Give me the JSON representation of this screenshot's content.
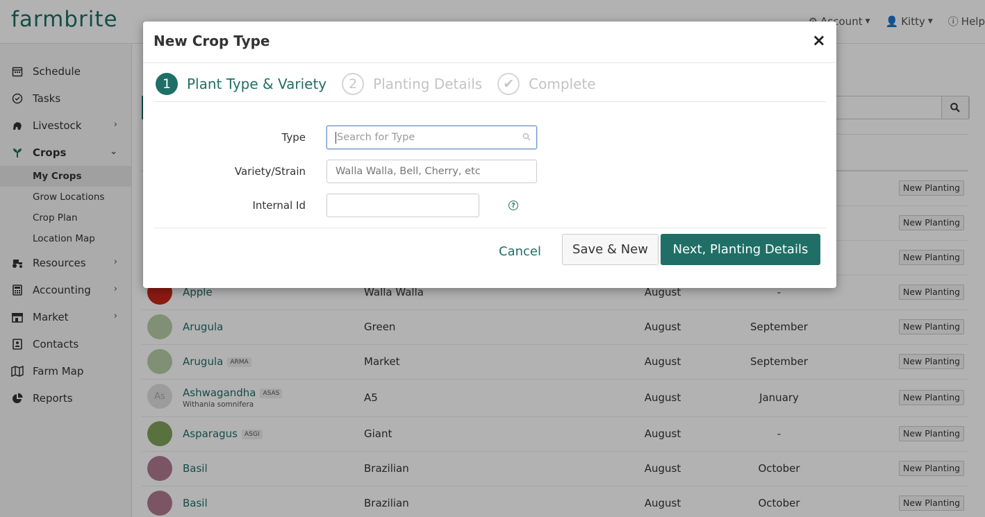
{
  "app": {
    "logo": "farmbrite"
  },
  "topnav": {
    "account": "Account",
    "user": "Kitty",
    "help": "Help"
  },
  "sidebar": {
    "items": [
      {
        "label": "Schedule"
      },
      {
        "label": "Tasks"
      },
      {
        "label": "Livestock"
      },
      {
        "label": "Crops"
      },
      {
        "label": "Resources"
      },
      {
        "label": "Accounting"
      },
      {
        "label": "Market"
      },
      {
        "label": "Contacts"
      },
      {
        "label": "Farm Map"
      },
      {
        "label": "Reports"
      }
    ],
    "crops_sub": [
      "My Crops",
      "Grow Locations",
      "Crop Plan",
      "Location Map"
    ]
  },
  "table": {
    "action_label": "New Planting",
    "rows": [
      {
        "name": "Apple",
        "badge": "",
        "sub": "",
        "variety": "Walla Walla",
        "m1": "August",
        "m2": "-"
      },
      {
        "name": "Arugula",
        "badge": "",
        "sub": "",
        "variety": "Green",
        "m1": "August",
        "m2": "September"
      },
      {
        "name": "Arugula",
        "badge": "ARMA",
        "sub": "",
        "variety": "Market",
        "m1": "August",
        "m2": "September"
      },
      {
        "name": "Ashwagandha",
        "badge": "ASAS",
        "sub": "Withania somnifera",
        "variety": "A5",
        "m1": "August",
        "m2": "January",
        "avatar_text": "As"
      },
      {
        "name": "Asparagus",
        "badge": "ASGI",
        "sub": "",
        "variety": "Giant",
        "m1": "August",
        "m2": "-"
      },
      {
        "name": "Basil",
        "badge": "",
        "sub": "",
        "variety": "Brazilian",
        "m1": "August",
        "m2": "October"
      },
      {
        "name": "Basil",
        "badge": "",
        "sub": "",
        "variety": "Brazilian",
        "m1": "August",
        "m2": "October"
      }
    ]
  },
  "modal": {
    "title": "New Crop Type",
    "close": "×",
    "steps": [
      {
        "num": "1",
        "label": "Plant Type & Variety"
      },
      {
        "num": "2",
        "label": "Planting Details"
      },
      {
        "num": "✔",
        "label": "Complete"
      }
    ],
    "fields": {
      "type_label": "Type",
      "type_placeholder": "Search for Type",
      "variety_label": "Variety/Strain",
      "variety_placeholder": "Walla Walla, Bell, Cherry, etc",
      "internal_id_label": "Internal Id",
      "internal_id_value": ""
    },
    "buttons": {
      "cancel": "Cancel",
      "save_new": "Save & New",
      "next": "Next, Planting Details"
    }
  },
  "colors": {
    "brand": "#1f6f66",
    "overlay": "rgba(0,0,0,0.3)"
  }
}
